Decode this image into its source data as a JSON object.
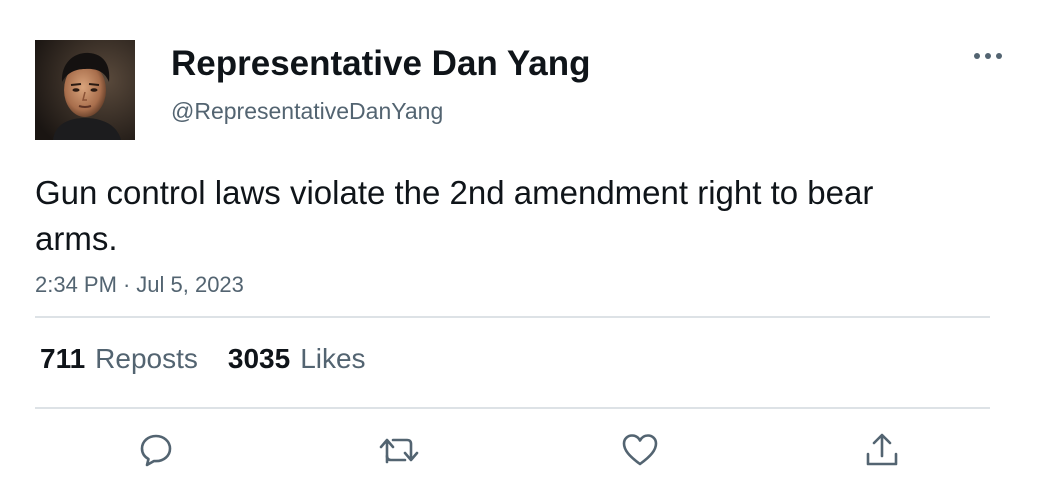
{
  "author": {
    "display_name": "Representative Dan Yang",
    "handle": "@RepresentativeDanYang",
    "avatar_icon": "profile-photo"
  },
  "tweet": {
    "text": "Gun control laws violate the 2nd amendment right to bear arms.",
    "time": "2:34 PM",
    "separator": "·",
    "date": "Jul 5, 2023"
  },
  "stats": {
    "reposts_count": "711",
    "reposts_label": "Reposts",
    "likes_count": "3035",
    "likes_label": "Likes"
  },
  "actions": {
    "reply_icon": "reply-icon",
    "repost_icon": "repost-icon",
    "like_icon": "heart-icon",
    "share_icon": "share-icon",
    "more_icon": "more-icon"
  },
  "colors": {
    "text_primary": "#0f1419",
    "text_secondary": "#536471",
    "divider": "#dde2e6",
    "icon": "#536471"
  }
}
